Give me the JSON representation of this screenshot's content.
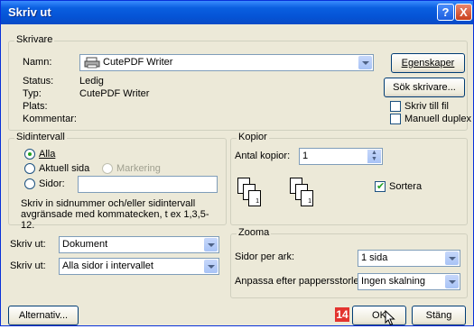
{
  "title": "Skriv ut",
  "titlebar_buttons": {
    "help": "?",
    "close": "X"
  },
  "printer": {
    "group_label": "Skrivare",
    "name_label": "Namn:",
    "name_value": "CutePDF Writer",
    "properties_button": "Egenskaper",
    "status_label": "Status:",
    "status_value": "Ledig",
    "type_label": "Typ:",
    "type_value": "CutePDF Writer",
    "location_label": "Plats:",
    "comment_label": "Kommentar:",
    "find_button": "Sök skrivare...",
    "print_to_file": "Skriv till fil",
    "manual_duplex": "Manuell duplex"
  },
  "page_range": {
    "group_label": "Sidintervall",
    "all": "Alla",
    "current": "Aktuell sida",
    "selection": "Markering",
    "pages": "Sidor:",
    "pages_value": "",
    "hint": "Skriv in sidnummer och/eller sidintervall avgränsade med kommatecken, t ex 1,3,5-12."
  },
  "copies": {
    "group_label": "Kopior",
    "count_label": "Antal kopior:",
    "count_value": "1",
    "collate": "Sortera",
    "collate_checked": true
  },
  "print_what": {
    "label": "Skriv ut:",
    "value": "Dokument"
  },
  "print": {
    "label": "Skriv ut:",
    "value": "Alla sidor i intervallet"
  },
  "zoom": {
    "group_label": "Zooma",
    "pages_per_sheet_label": "Sidor per ark:",
    "pages_per_sheet_value": "1 sida",
    "scale_label": "Anpassa efter pappersstorlek:",
    "scale_value": "Ingen skalning"
  },
  "buttons": {
    "options": "Alternativ...",
    "ok": "OK",
    "cancel": "Stäng"
  },
  "annotation_badge": "14",
  "colors": {
    "title_blue": "#0553d5",
    "dialog_bg": "#ece9d8",
    "badge_red": "#e3342f",
    "check_green": "#21a121"
  }
}
